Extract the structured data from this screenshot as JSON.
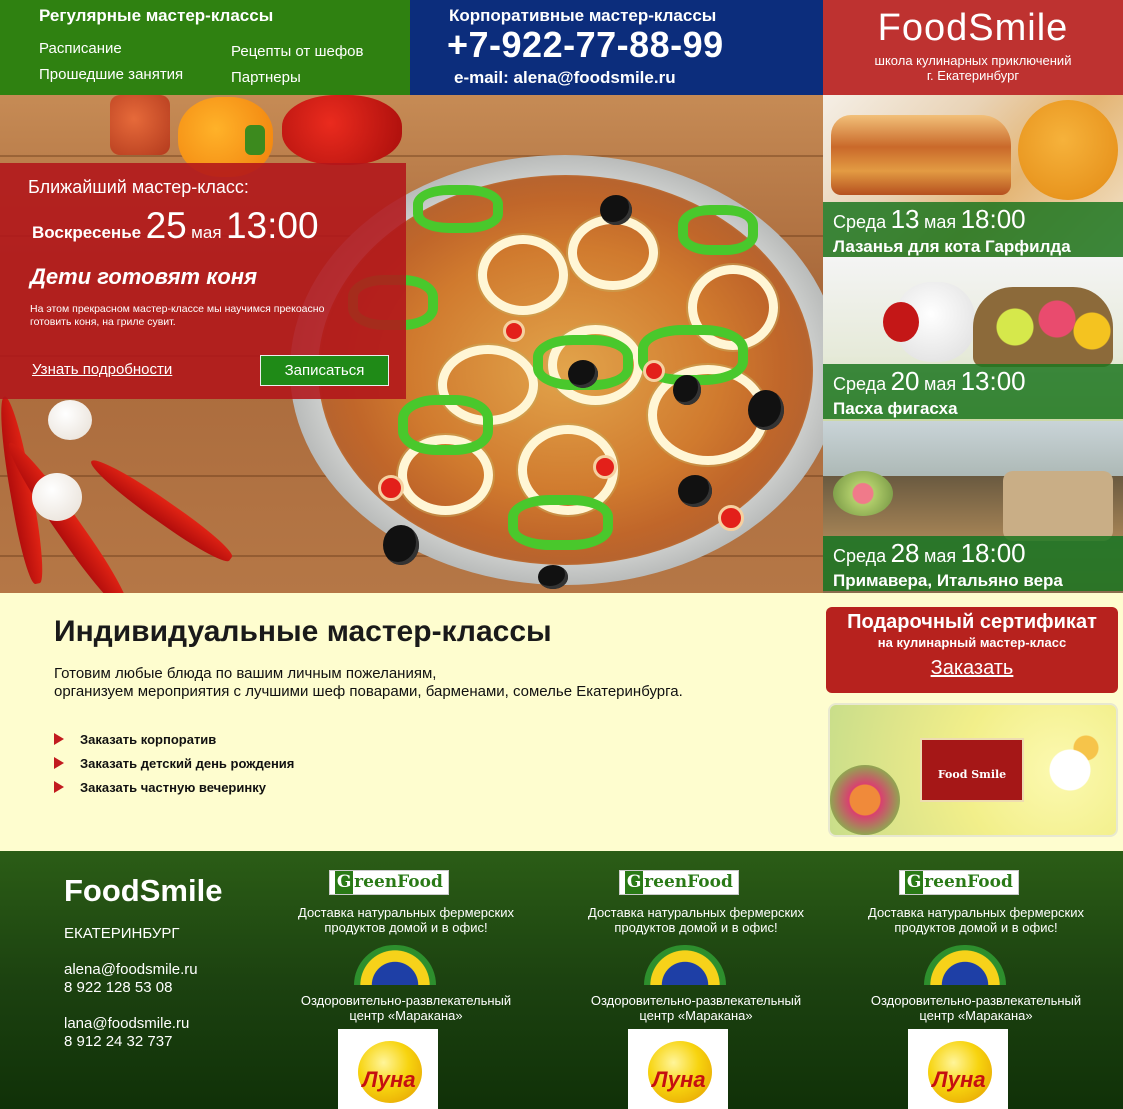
{
  "header": {
    "regular": {
      "title": "Регулярные мастер-классы",
      "links": [
        "Расписание",
        "Прошедшие занятия",
        "Рецепты от шефов",
        "Партнеры"
      ]
    },
    "corporate": {
      "title": "Корпоративные мастер-классы",
      "phone": "+7-922-77-88-99",
      "email": "e-mail: alena@foodsmile.ru"
    },
    "brand": {
      "name": "FoodSmile",
      "tagline": "школа кулинарных приключений",
      "city": "г. Екатеринбург"
    }
  },
  "hero": {
    "promo": {
      "heading": "Ближайший мастер-класс:",
      "weekday": "Воскресенье",
      "day": "25",
      "month": "мая",
      "time": "13:00",
      "name": "Дети готовят коня",
      "description": "На этом прекрасном мастер-классе мы научимся прекоасно готовить коня, на гриле сувит.",
      "more_link": "Узнать подробности",
      "signup_button": "Записаться"
    }
  },
  "events": [
    {
      "weekday": "Среда",
      "day": "13",
      "month": "мая",
      "time": "18:00",
      "title": "Лазанья для кота Гарфилда"
    },
    {
      "weekday": "Среда",
      "day": "20",
      "month": "мая",
      "time": "13:00",
      "title": "Пасха фигасха"
    },
    {
      "weekday": "Среда",
      "day": "28",
      "month": "мая",
      "time": "18:00",
      "title": "Примавера, Итальяно вера"
    }
  ],
  "individual": {
    "title": "Индивидуальные мастер-классы",
    "text_line1": "Готовим любые блюда по вашим личным пожеланиям,",
    "text_line2": "организуем мероприятия с лучшими шеф поварами, барменами, сомелье Екатеринбурга.",
    "links": [
      "Заказать корпоратив",
      "Заказать детский день рождения",
      "Заказать частную вечеринку"
    ]
  },
  "gift": {
    "title": "Подарочный сертификат",
    "subtitle": "на кулинарный мастер-класс",
    "order_link": "Заказать",
    "card_logo": "Food Smile"
  },
  "footer": {
    "brand": "FoodSmile",
    "city": "ЕКАТЕРИНБУРГ",
    "contacts": [
      {
        "email": "alena@foodsmile.ru",
        "phone": "8 922 128 53 08"
      },
      {
        "email": "lana@foodsmile.ru",
        "phone": "8 912 24 32 737"
      }
    ],
    "partners": [
      {
        "greenfood_logo": "reenFood",
        "greenfood_logo_g": "G",
        "greenfood_text": [
          "Доставка натуральных фермерских",
          "продуктов домой и в офис!"
        ],
        "maracana_text": [
          "Оздоровительно-развлекательный",
          "центр «Маракана»"
        ],
        "luna_logo": "Луна"
      },
      {
        "greenfood_logo": "reenFood",
        "greenfood_logo_g": "G",
        "greenfood_text": [
          "Доставка натуральных фермерских",
          "продуктов домой и в офис!"
        ],
        "maracana_text": [
          "Оздоровительно-развлекательный",
          "центр «Маракана»"
        ],
        "luna_logo": "Луна"
      },
      {
        "greenfood_logo": "reenFood",
        "greenfood_logo_g": "G",
        "greenfood_text": [
          "Доставка натуральных фермерских",
          "продуктов домой и в офис!"
        ],
        "maracana_text": [
          "Оздоровительно-развлекательный",
          "центр «Маракана»"
        ],
        "luna_logo": "Луна"
      }
    ]
  },
  "colors": {
    "green": "#2f8111",
    "blue": "#0c2d7c",
    "red": "#be3230",
    "cream": "#fefdcf",
    "footer_green": "#1c4210"
  }
}
